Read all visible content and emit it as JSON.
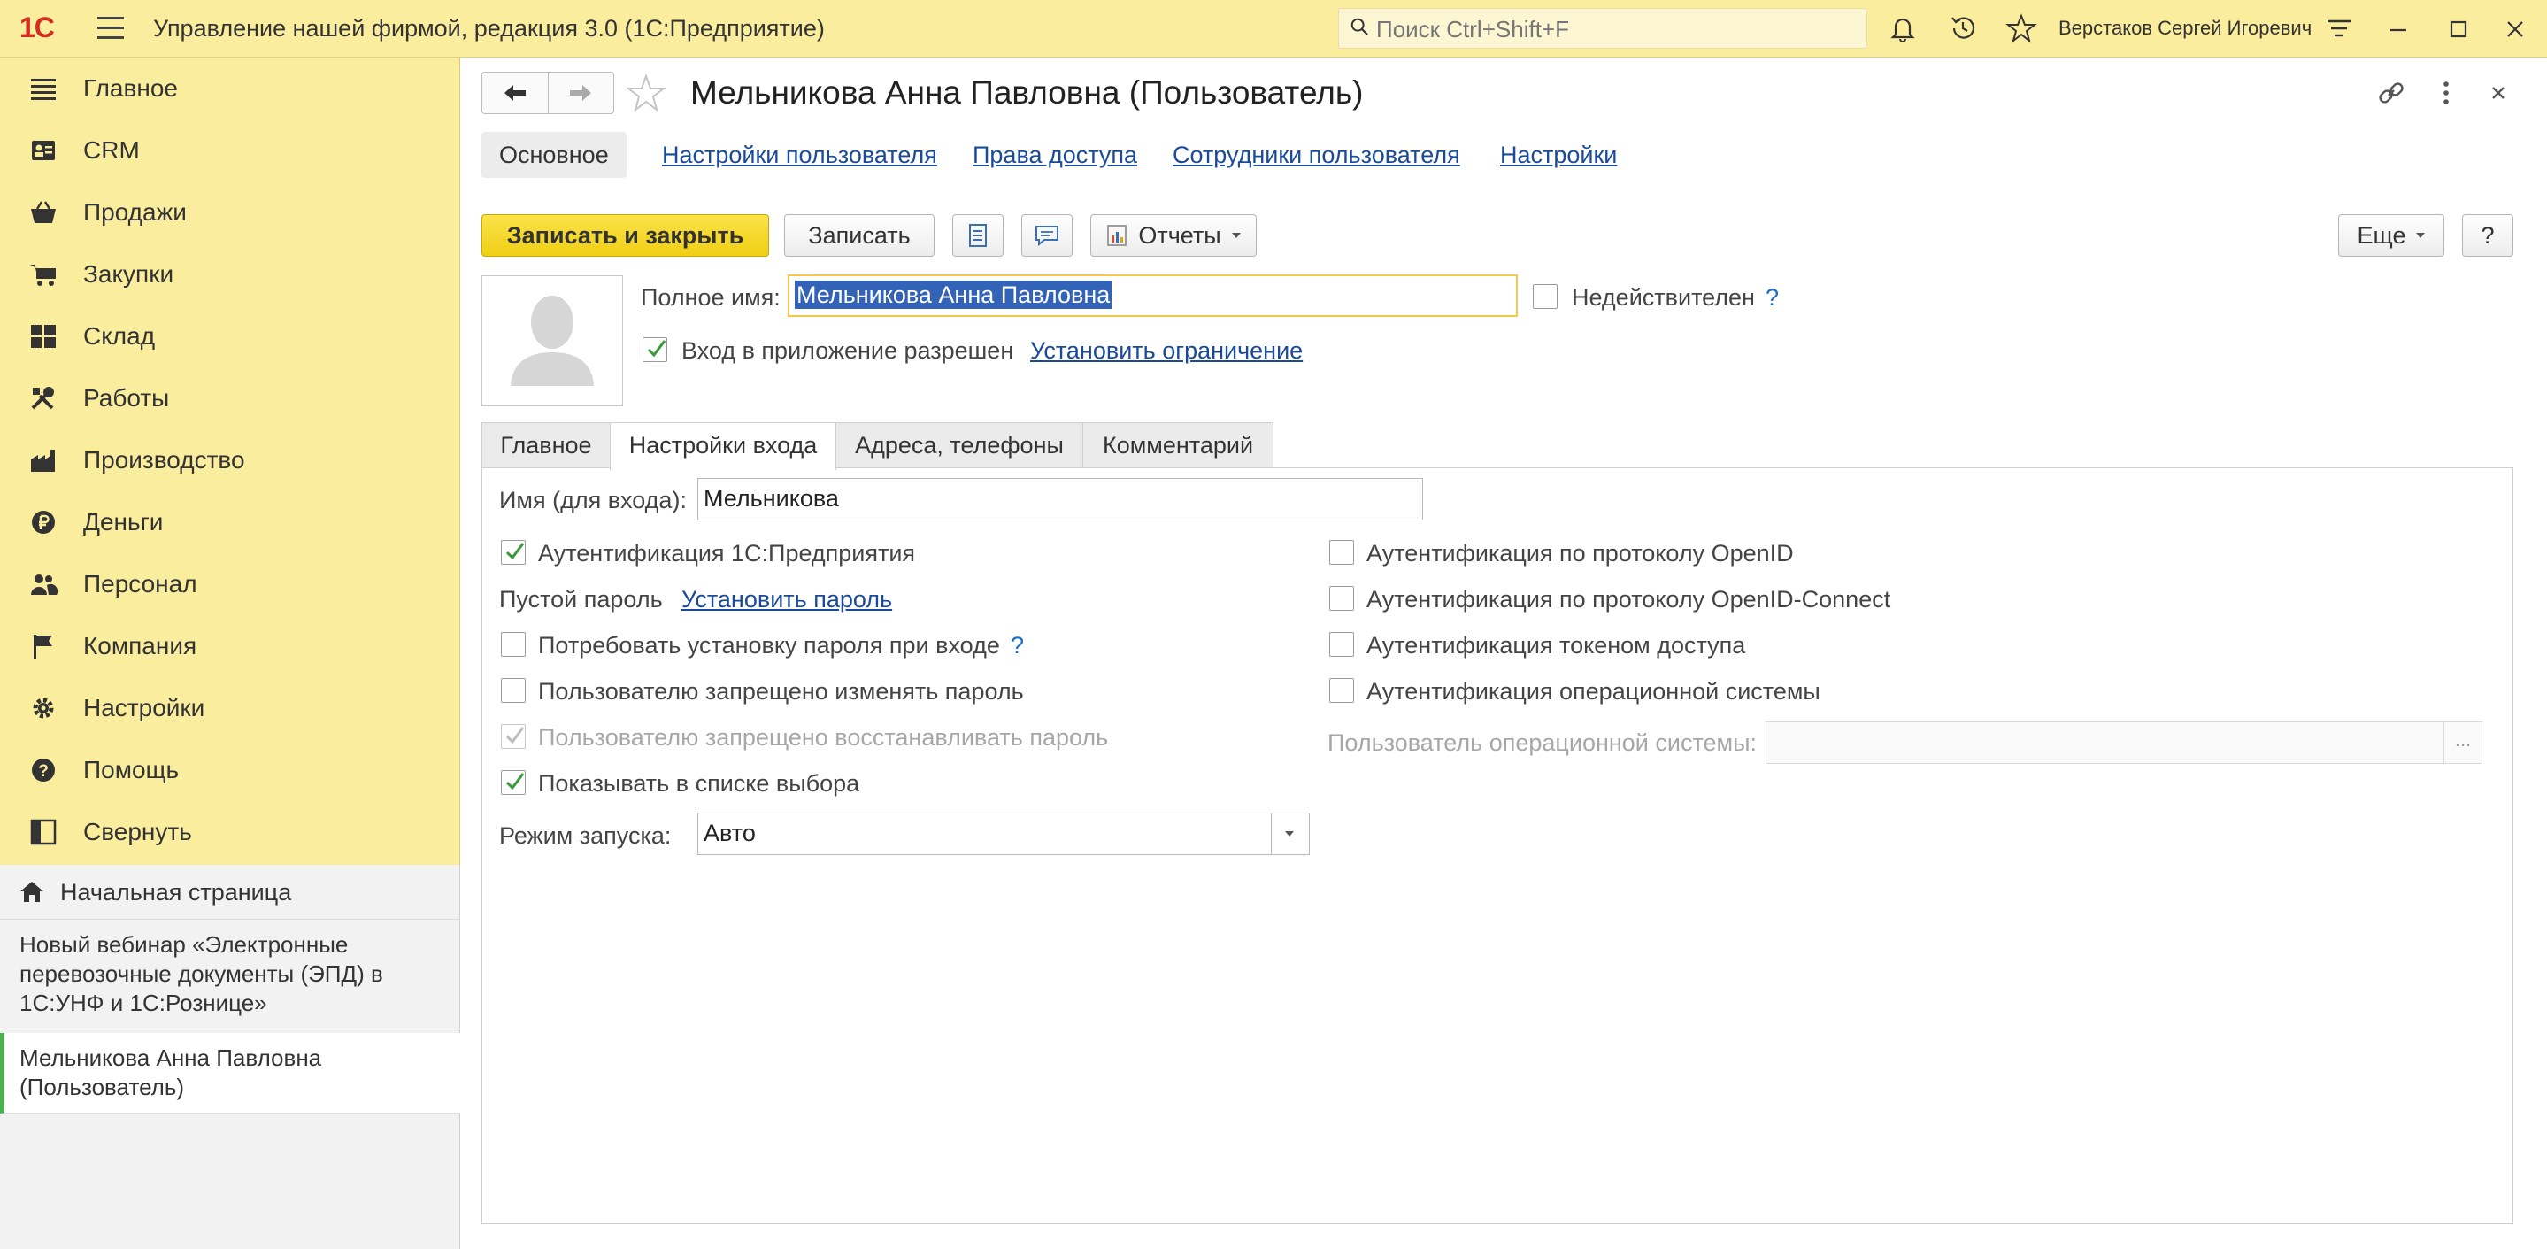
{
  "topbar": {
    "logo": "1С",
    "app_title": "Управление нашей фирмой, редакция 3.0  (1С:Предприятие)",
    "search_placeholder": "Поиск Ctrl+Shift+F",
    "user_name": "Верстаков Сергей Игоревич"
  },
  "sidebar": {
    "items": [
      {
        "label": "Главное",
        "icon": "list-icon"
      },
      {
        "label": "CRM",
        "icon": "contacts-icon"
      },
      {
        "label": "Продажи",
        "icon": "basket-icon"
      },
      {
        "label": "Закупки",
        "icon": "cart-icon"
      },
      {
        "label": "Склад",
        "icon": "grid-icon"
      },
      {
        "label": "Работы",
        "icon": "tools-icon"
      },
      {
        "label": "Производство",
        "icon": "factory-icon"
      },
      {
        "label": "Деньги",
        "icon": "ruble-icon"
      },
      {
        "label": "Персонал",
        "icon": "people-icon"
      },
      {
        "label": "Компания",
        "icon": "flag-icon"
      },
      {
        "label": "Настройки",
        "icon": "gear-icon"
      },
      {
        "label": "Помощь",
        "icon": "help-icon"
      },
      {
        "label": "Свернуть",
        "icon": "collapse-icon"
      }
    ],
    "home": "Начальная страница",
    "open_windows": [
      "Новый вебинар «Электронные перевозочные документы (ЭПД) в 1С:УНФ и 1С:Рознице»",
      "Мельникова Анна Павловна (Пользователь)"
    ]
  },
  "form": {
    "title": "Мельникова Анна Павловна (Пользователь)",
    "tabs": [
      "Основное",
      "Настройки пользователя",
      "Права доступа",
      "Сотрудники пользователя",
      "Настройки"
    ],
    "toolbar": {
      "save_close": "Записать и закрыть",
      "save": "Записать",
      "reports": "Отчеты",
      "more": "Еще",
      "help": "?"
    },
    "full_name_label": "Полное имя:",
    "full_name_value": "Мельникова Анна Павловна",
    "invalid_label": "Недействителен",
    "invalid_help": "?",
    "login_allowed_label": "Вход в приложение разрешен",
    "set_restriction": "Установить ограничение",
    "inner_tabs": [
      "Главное",
      "Настройки входа",
      "Адреса, телефоны",
      "Комментарий"
    ],
    "login_name_label": "Имя (для входа):",
    "login_name_value": "Мельникова",
    "auth_1c": "Аутентификация 1С:Предприятия",
    "empty_password": "Пустой пароль",
    "set_password": "Установить пароль",
    "require_password": "Потребовать установку пароля при входе",
    "require_password_help": "?",
    "deny_change_password": "Пользователю запрещено изменять пароль",
    "deny_restore_password": "Пользователю запрещено восстанавливать пароль",
    "show_in_list": "Показывать в списке выбора",
    "launch_mode_label": "Режим запуска:",
    "launch_mode_value": "Авто",
    "auth_openid": "Аутентификация по протоколу OpenID",
    "auth_openid_connect": "Аутентификация по протоколу OpenID-Connect",
    "auth_token": "Аутентификация токеном доступа",
    "auth_os": "Аутентификация операционной системы",
    "os_user_label": "Пользователь операционной системы:",
    "os_user_browse": "..."
  },
  "state": {
    "login_allowed": true,
    "invalid": false,
    "auth_1c": true,
    "require_password": false,
    "deny_change_password": false,
    "deny_restore_password": true,
    "show_in_list": true,
    "auth_openid": false,
    "auth_openid_connect": false,
    "auth_token": false,
    "auth_os": false
  },
  "colors": {
    "topbar": "#fbed9e",
    "primary_button": "#f0cf14",
    "link": "#1a4b9b",
    "check_green": "#3a9a3a",
    "logo_red": "#d62b1f"
  }
}
